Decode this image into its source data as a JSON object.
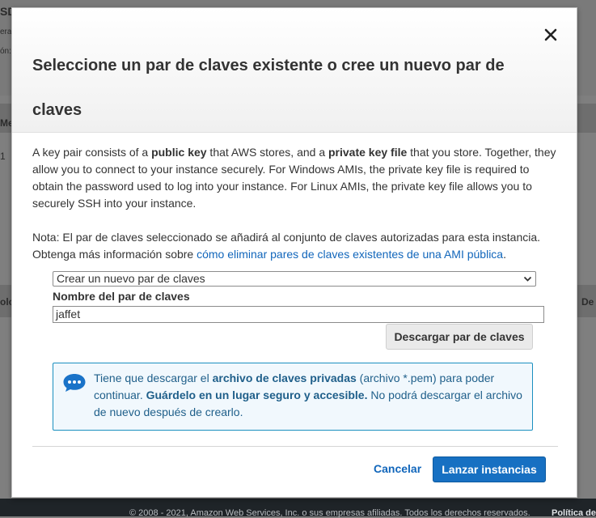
{
  "background": {
    "left_fragments": [
      "SD",
      "era",
      "ón:",
      "Me",
      "1",
      "olo"
    ],
    "right_fragment": "De",
    "footer_copyright": "© 2008 - 2021, Amazon Web Services, Inc. o sus empresas afiliadas. Todos los derechos reservados.",
    "footer_policy": "Política de"
  },
  "modal": {
    "title": "Seleccione un par de claves existente o cree un nuevo par de claves",
    "close_icon": "close-icon",
    "description": {
      "p1": "A key pair consists of a ",
      "b1": "public key",
      "p2": " that AWS stores, and a ",
      "b2": "private key file",
      "p3": " that you store. Together, they allow you to connect to your instance securely. For Windows AMIs, the private key file is required to obtain the password used to log into your instance. For Linux AMIs, the private key file allows you to securely SSH into your instance."
    },
    "note": {
      "text": "Nota: El par de claves seleccionado se añadirá al conjunto de claves autorizadas para esta instancia. Obtenga más información sobre ",
      "link": "cómo eliminar pares de claves existentes de una AMI pública",
      "end": "."
    },
    "select": {
      "value": "Crear un nuevo par de claves",
      "icon": "chevron-down-icon"
    },
    "key_name_label": "Nombre del par de claves",
    "key_name_value": "jaffet",
    "download_button": "Descargar par de claves",
    "info": {
      "icon": "chat-bubble-icon",
      "t1": "Tiene que descargar el ",
      "b1": "archivo de claves privadas",
      "t2": " (archivo *.pem) para poder continuar. ",
      "b2": "Guárdelo en un lugar seguro y accesible.",
      "t3": " No podrá descargar el archivo de nuevo después de crearlo."
    },
    "cancel_label": "Cancelar",
    "launch_label": "Lanzar instancias",
    "colors": {
      "primary_button": "#1770c2",
      "link": "#1166bb",
      "info_border": "#1a8fbf",
      "info_text": "#1f5f8a"
    }
  }
}
